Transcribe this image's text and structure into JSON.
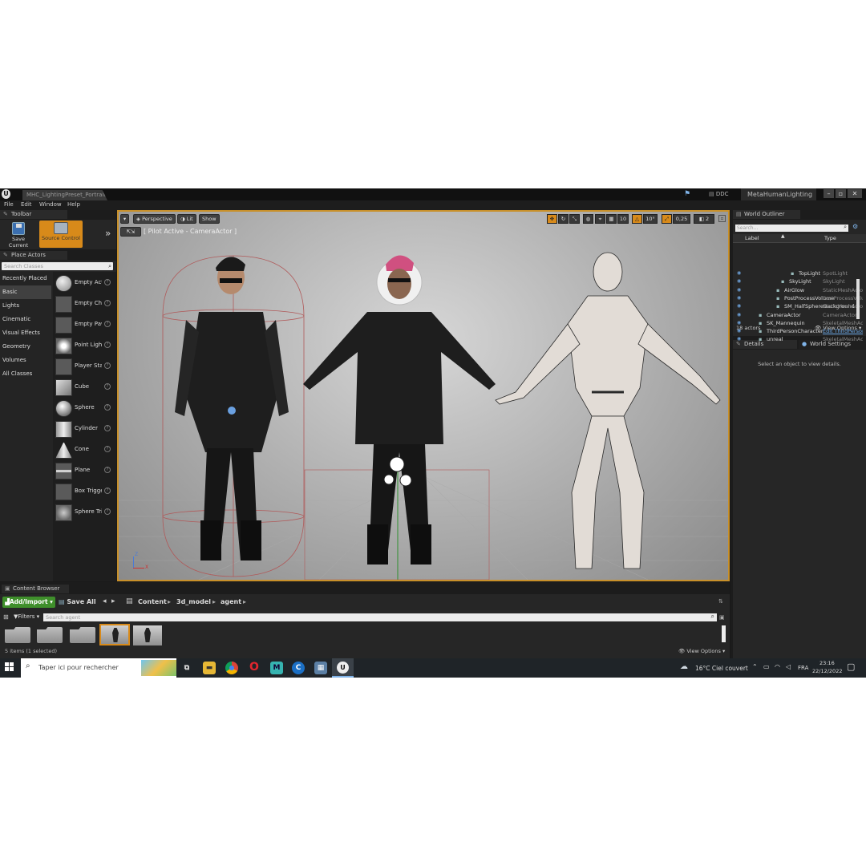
{
  "window": {
    "document_tab": "MHC_LightingPreset_Portrait",
    "ddc_label": "DDC",
    "project_name": "MetaHumanLighting"
  },
  "menu": [
    "File",
    "Edit",
    "Window",
    "Help"
  ],
  "toolbar": {
    "title": "Toolbar",
    "save_current": "Save Current",
    "source_control": "Source Control"
  },
  "place_actors": {
    "title": "Place Actors",
    "search_placeholder": "Search Classes",
    "categories": [
      "Recently Placed",
      "Basic",
      "Lights",
      "Cinematic",
      "Visual Effects",
      "Geometry",
      "Volumes",
      "All Classes"
    ],
    "selected_category": "Basic",
    "items": [
      "Empty Actor",
      "Empty Character",
      "Empty Pawn",
      "Point Light",
      "Player Start",
      "Cube",
      "Sphere",
      "Cylinder",
      "Cone",
      "Plane",
      "Box Trigger",
      "Sphere Trigger"
    ]
  },
  "viewport": {
    "perspective": "Perspective",
    "lit": "Lit",
    "show": "Show",
    "pilot_label": "[ Pilot Active - CameraActor ]",
    "grid_snap": "10",
    "rotation_snap": "10°",
    "scale_snap": "0,25",
    "camera_speed": "2",
    "axis_x": "X",
    "axis_z": "Z"
  },
  "world_outliner": {
    "title": "World Outliner",
    "search_placeholder": "Search...",
    "col_label": "Label",
    "col_type": "Type",
    "rows": [
      {
        "label": "TopLight",
        "type": "SpotLight",
        "link": false
      },
      {
        "label": "SkyLight",
        "type": "SkyLight",
        "link": false
      },
      {
        "label": "AirGlow",
        "type": "StaticMeshActor",
        "link": false
      },
      {
        "label": "PostProcessVolume",
        "type": "PostProcessVolume",
        "link": false
      },
      {
        "label": "SM_HalfSphereBackground",
        "type": "StaticMeshActor",
        "link": false
      },
      {
        "label": "CameraActor",
        "type": "CameraActor",
        "link": false
      },
      {
        "label": "SK_Mannequin",
        "type": "SkeletalMeshActor",
        "link": false
      },
      {
        "label": "ThirdPersonCharacter",
        "type": "Edit ThirdPersonCharacter",
        "link": true
      },
      {
        "label": "unreal",
        "type": "SkeletalMeshActor",
        "link": false
      }
    ],
    "actor_count": "18 actors",
    "view_options": "View Options"
  },
  "details": {
    "tab_details": "Details",
    "tab_world_settings": "World Settings",
    "empty_message": "Select an object to view details."
  },
  "content_browser": {
    "title": "Content Browser",
    "add_import": "Add/Import",
    "save_all": "Save All",
    "path": [
      "Content",
      "3d_model",
      "agent"
    ],
    "filters": "Filters",
    "search_placeholder": "Search agent",
    "status": "5 items (1 selected)",
    "view_options": "View Options"
  },
  "taskbar": {
    "search_placeholder": "Taper ici pour rechercher",
    "weather": "16°C  Ciel couvert",
    "language": "FRA",
    "time": "23:16",
    "date": "22/12/2022"
  },
  "colors": {
    "accent_orange": "#d88a1a",
    "add_import_green": "#3f8f2b",
    "link_blue": "#6aa8e8",
    "panel_bg": "#262626"
  }
}
